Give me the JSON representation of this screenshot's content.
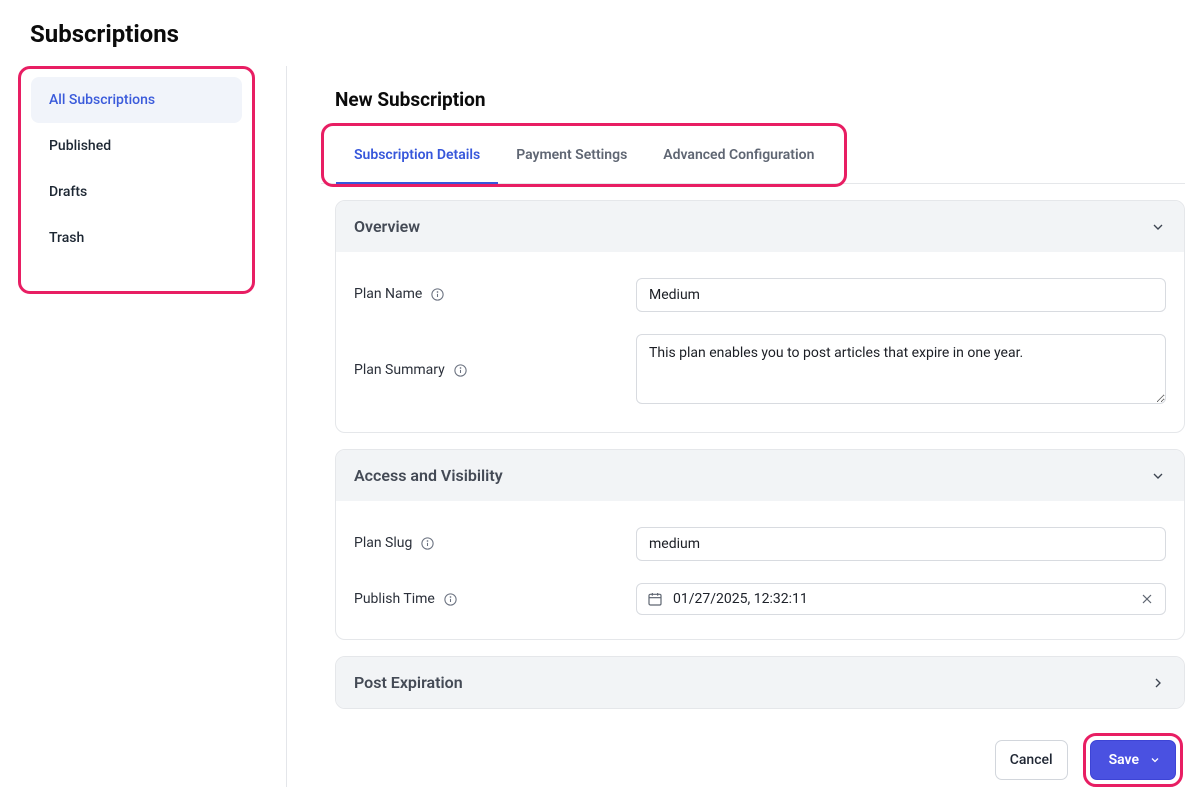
{
  "page_title": "Subscriptions",
  "sidebar": {
    "items": [
      {
        "label": "All Subscriptions",
        "active": true
      },
      {
        "label": "Published",
        "active": false
      },
      {
        "label": "Drafts",
        "active": false
      },
      {
        "label": "Trash",
        "active": false
      }
    ]
  },
  "content": {
    "title": "New Subscription",
    "tabs": [
      {
        "label": "Subscription Details",
        "active": true
      },
      {
        "label": "Payment Settings",
        "active": false
      },
      {
        "label": "Advanced Configuration",
        "active": false
      }
    ],
    "sections": {
      "overview": {
        "title": "Overview",
        "expanded": true,
        "fields": {
          "plan_name": {
            "label": "Plan Name",
            "value": "Medium"
          },
          "plan_summary": {
            "label": "Plan Summary",
            "value": "This plan enables you to post articles that expire in one year."
          }
        }
      },
      "access": {
        "title": "Access and Visibility",
        "expanded": true,
        "fields": {
          "plan_slug": {
            "label": "Plan Slug",
            "value": "medium"
          },
          "publish_time": {
            "label": "Publish Time",
            "value": "01/27/2025, 12:32:11"
          }
        }
      },
      "post_expiration": {
        "title": "Post Expiration",
        "expanded": false
      }
    },
    "actions": {
      "cancel": "Cancel",
      "save": "Save"
    }
  }
}
